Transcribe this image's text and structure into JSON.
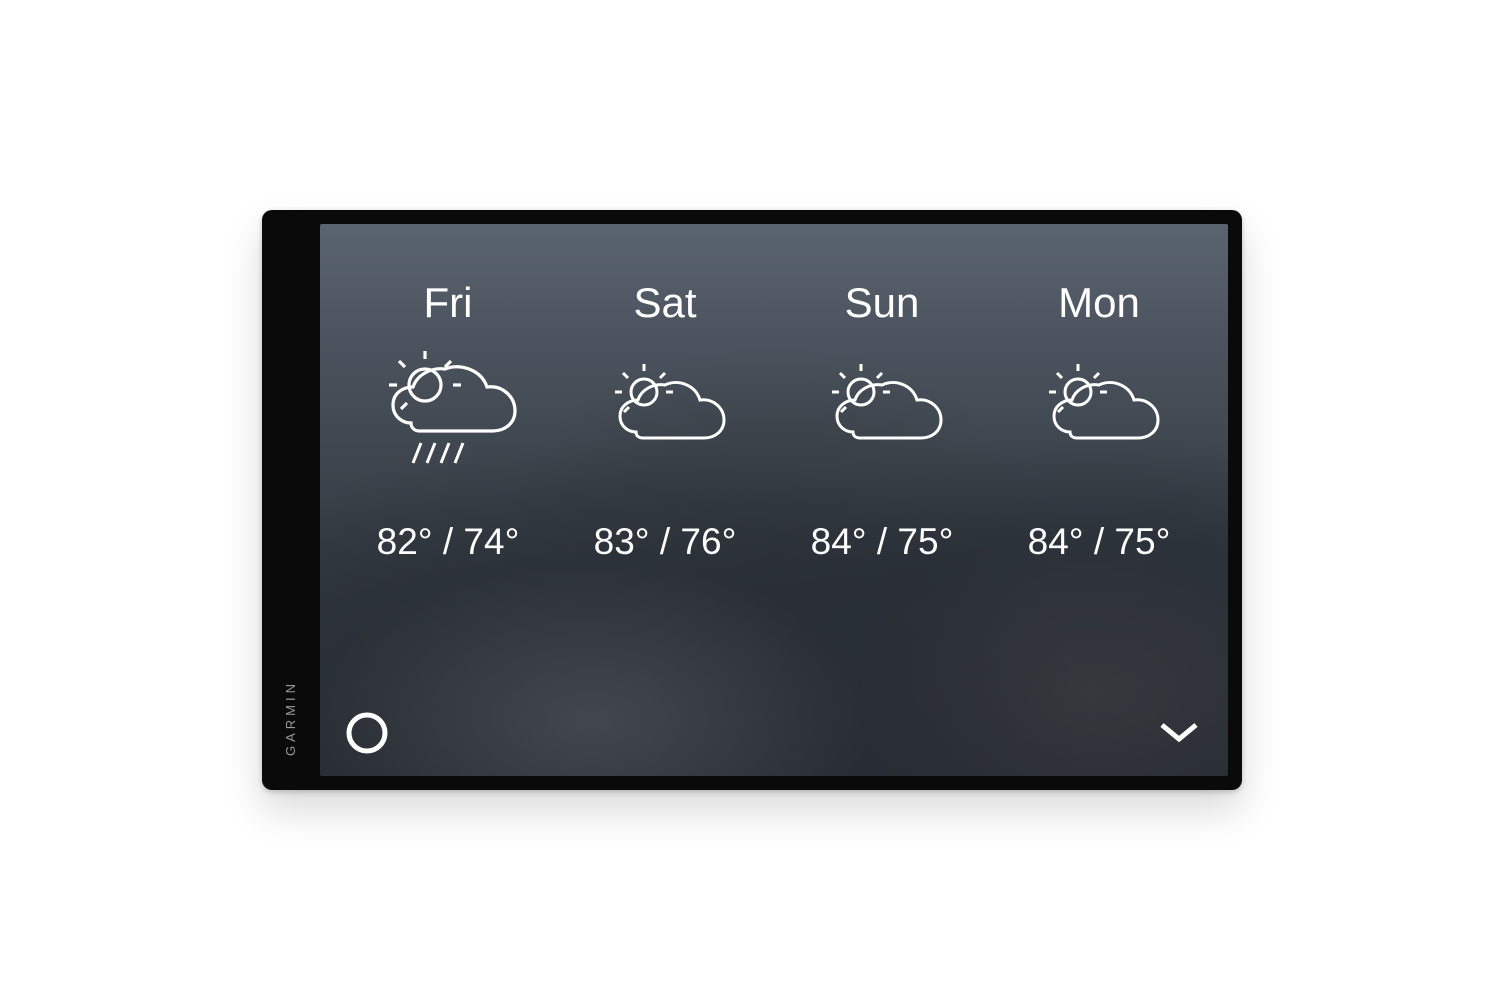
{
  "device": {
    "brand": "GARMIN"
  },
  "forecast": [
    {
      "day": "Fri",
      "condition": "partly-cloudy-rain",
      "high": "82°",
      "low": "74°"
    },
    {
      "day": "Sat",
      "condition": "partly-cloudy",
      "high": "83°",
      "low": "76°"
    },
    {
      "day": "Sun",
      "condition": "partly-cloudy",
      "high": "84°",
      "low": "75°"
    },
    {
      "day": "Mon",
      "condition": "partly-cloudy",
      "high": "84°",
      "low": "75°"
    }
  ],
  "icons": {
    "voice_assistant": "alexa-icon",
    "expand": "chevron-down-icon"
  }
}
